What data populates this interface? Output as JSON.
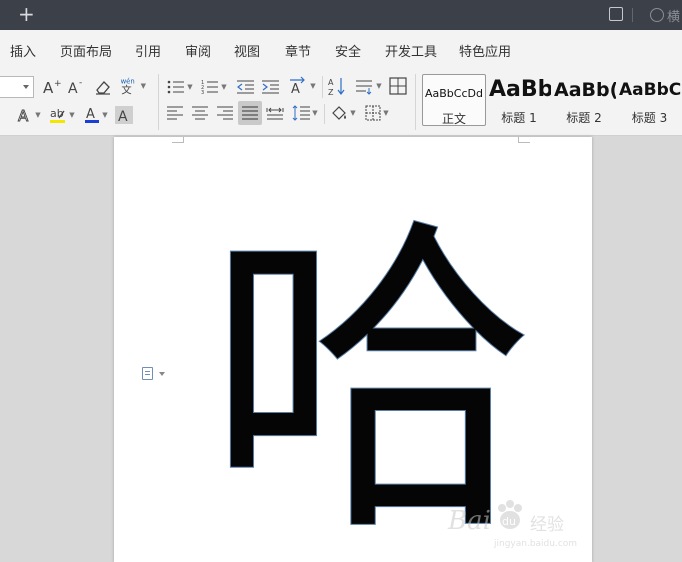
{
  "titlebar": {
    "new_tab_symbol": "+",
    "mode_label": "横",
    "icons": [
      "plus-icon",
      "window-icon",
      "mode-icon"
    ]
  },
  "menu": {
    "tabs": [
      "插入",
      "页面布局",
      "引用",
      "审阅",
      "视图",
      "章节",
      "安全",
      "开发工具",
      "特色应用"
    ]
  },
  "ribbon": {
    "font_size_value": "",
    "toolbar_icons": [
      "grow-font-icon",
      "shrink-font-icon",
      "clear-format-icon",
      "phonetic-guide-icon",
      "bullets-icon",
      "numbering-icon",
      "decrease-indent-icon",
      "increase-indent-icon",
      "text-direction-icon",
      "sort-icon",
      "line-spacing-options-icon",
      "table-border-icon",
      "text-effect-icon",
      "highlight-icon",
      "font-color-icon",
      "char-shading-icon",
      "align-left-icon",
      "align-center-icon",
      "align-right-icon",
      "justify-icon",
      "distribute-icon",
      "line-spacing-icon",
      "shading-icon",
      "borders-icon"
    ],
    "phonetic_glyph": "wén\n文",
    "styles": [
      {
        "sample": "AaBbCcDd",
        "name": "正文"
      },
      {
        "sample": "AaBb",
        "name": "标题 1"
      },
      {
        "sample": "AaBb(",
        "name": "标题 2"
      },
      {
        "sample": "AaBbC",
        "name": "标题 3"
      }
    ]
  },
  "document": {
    "content_character": "哈",
    "paste_options_icon": "paste-options-icon"
  },
  "watermark": {
    "brand": "Bai",
    "paw": "du",
    "cn": "经验",
    "url": "jingyan.baidu.com"
  },
  "colors": {
    "titlebar_bg": "#3c4049",
    "ribbon_bg": "#f3f3f3",
    "workspace_bg": "#d8d8d8",
    "font_color_underline": "#1a3fd6",
    "highlight_underline": "#f5e600"
  }
}
